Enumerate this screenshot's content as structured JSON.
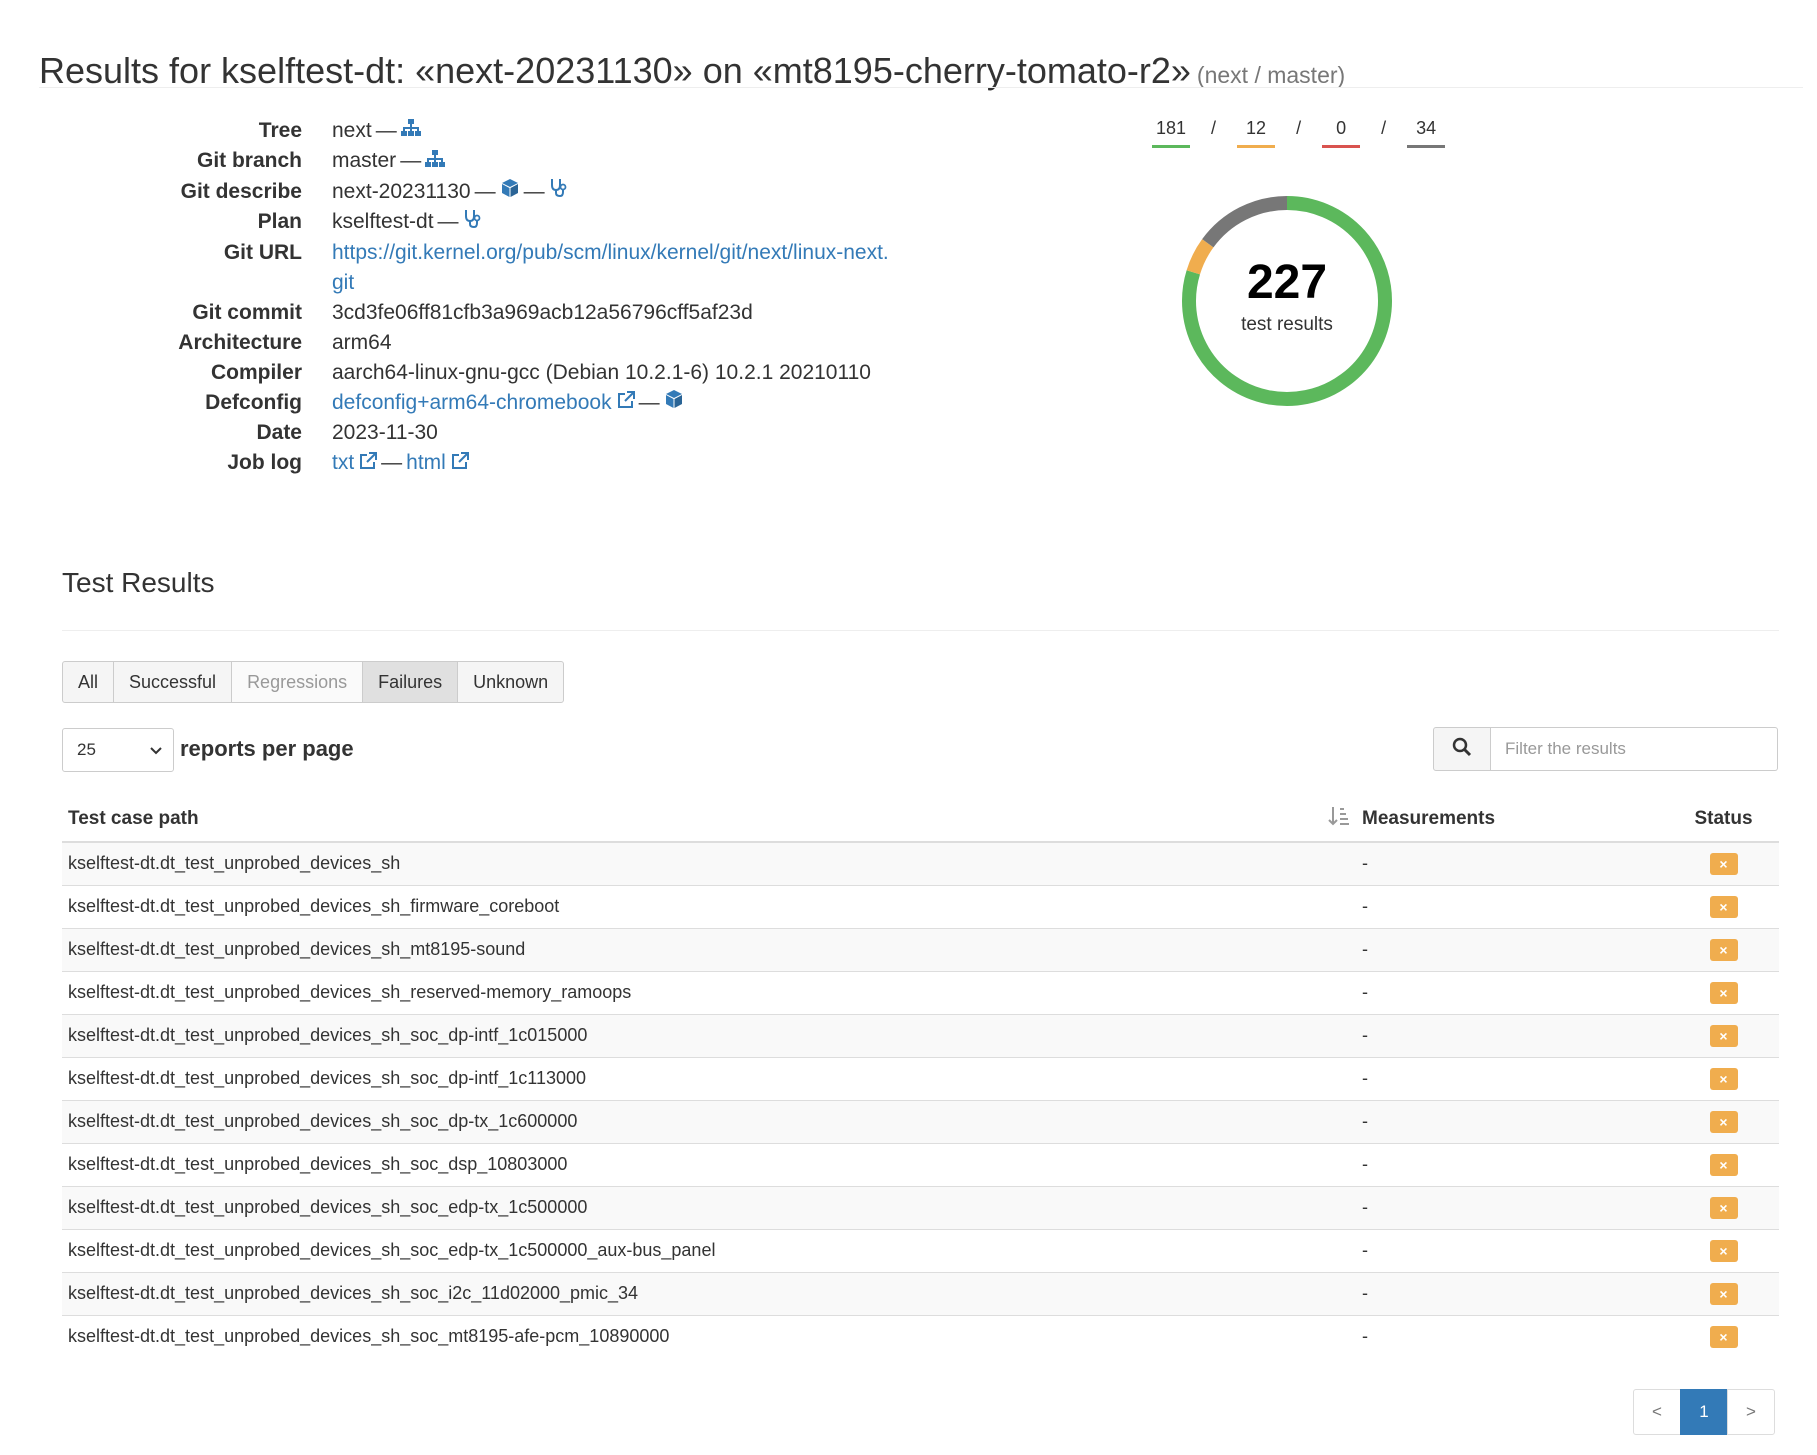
{
  "header": {
    "title": "Results for kselftest-dt: «next-20231130» on «mt8195-cherry-tomato-r2»",
    "subtitle": "(next / master)"
  },
  "details": {
    "tree": {
      "label": "Tree",
      "value": "next"
    },
    "git_branch": {
      "label": "Git branch",
      "value": "master"
    },
    "git_describe": {
      "label": "Git describe",
      "value": "next-20231130"
    },
    "plan": {
      "label": "Plan",
      "value": "kselftest-dt"
    },
    "git_url": {
      "label": "Git URL",
      "value": "https://git.kernel.org/pub/scm/linux/kernel/git/next/linux-next.git"
    },
    "git_commit": {
      "label": "Git commit",
      "value": "3cd3fe06ff81cfb3a969acb12a56796cff5af23d"
    },
    "architecture": {
      "label": "Architecture",
      "value": "arm64"
    },
    "compiler": {
      "label": "Compiler",
      "value": "aarch64-linux-gnu-gcc (Debian 10.2.1-6) 10.2.1 20210110"
    },
    "defconfig": {
      "label": "Defconfig",
      "value": "defconfig+arm64-chromebook"
    },
    "date": {
      "label": "Date",
      "value": "2023-11-30"
    },
    "job_log": {
      "label": "Job log",
      "txt": "txt",
      "html": "html"
    },
    "separator": "—"
  },
  "summary": {
    "pass": "181",
    "regressions": "12",
    "fail": "0",
    "unknown": "34",
    "slash": "/",
    "total": "227",
    "total_label": "test results",
    "colors": {
      "pass": "#5cb85c",
      "regressions": "#f0ad4e",
      "fail": "#d9534f",
      "unknown": "#777777"
    }
  },
  "results": {
    "section_title": "Test Results",
    "filters": [
      "All",
      "Successful",
      "Regressions",
      "Failures",
      "Unknown"
    ],
    "per_page_value": "25",
    "per_page_label": "reports per page",
    "search_placeholder": "Filter the results",
    "columns": {
      "path": "Test case path",
      "measurements": "Measurements",
      "status": "Status"
    },
    "status_glyph": "×",
    "rows": [
      {
        "path": "kselftest-dt.dt_test_unprobed_devices_sh",
        "measurements": "-"
      },
      {
        "path": "kselftest-dt.dt_test_unprobed_devices_sh_firmware_coreboot",
        "measurements": "-"
      },
      {
        "path": "kselftest-dt.dt_test_unprobed_devices_sh_mt8195-sound",
        "measurements": "-"
      },
      {
        "path": "kselftest-dt.dt_test_unprobed_devices_sh_reserved-memory_ramoops",
        "measurements": "-"
      },
      {
        "path": "kselftest-dt.dt_test_unprobed_devices_sh_soc_dp-intf_1c015000",
        "measurements": "-"
      },
      {
        "path": "kselftest-dt.dt_test_unprobed_devices_sh_soc_dp-intf_1c113000",
        "measurements": "-"
      },
      {
        "path": "kselftest-dt.dt_test_unprobed_devices_sh_soc_dp-tx_1c600000",
        "measurements": "-"
      },
      {
        "path": "kselftest-dt.dt_test_unprobed_devices_sh_soc_dsp_10803000",
        "measurements": "-"
      },
      {
        "path": "kselftest-dt.dt_test_unprobed_devices_sh_soc_edp-tx_1c500000",
        "measurements": "-"
      },
      {
        "path": "kselftest-dt.dt_test_unprobed_devices_sh_soc_edp-tx_1c500000_aux-bus_panel",
        "measurements": "-"
      },
      {
        "path": "kselftest-dt.dt_test_unprobed_devices_sh_soc_i2c_11d02000_pmic_34",
        "measurements": "-"
      },
      {
        "path": "kselftest-dt.dt_test_unprobed_devices_sh_soc_mt8195-afe-pcm_10890000",
        "measurements": "-"
      }
    ],
    "pagination": {
      "prev": "<",
      "current": "1",
      "next": ">"
    }
  }
}
